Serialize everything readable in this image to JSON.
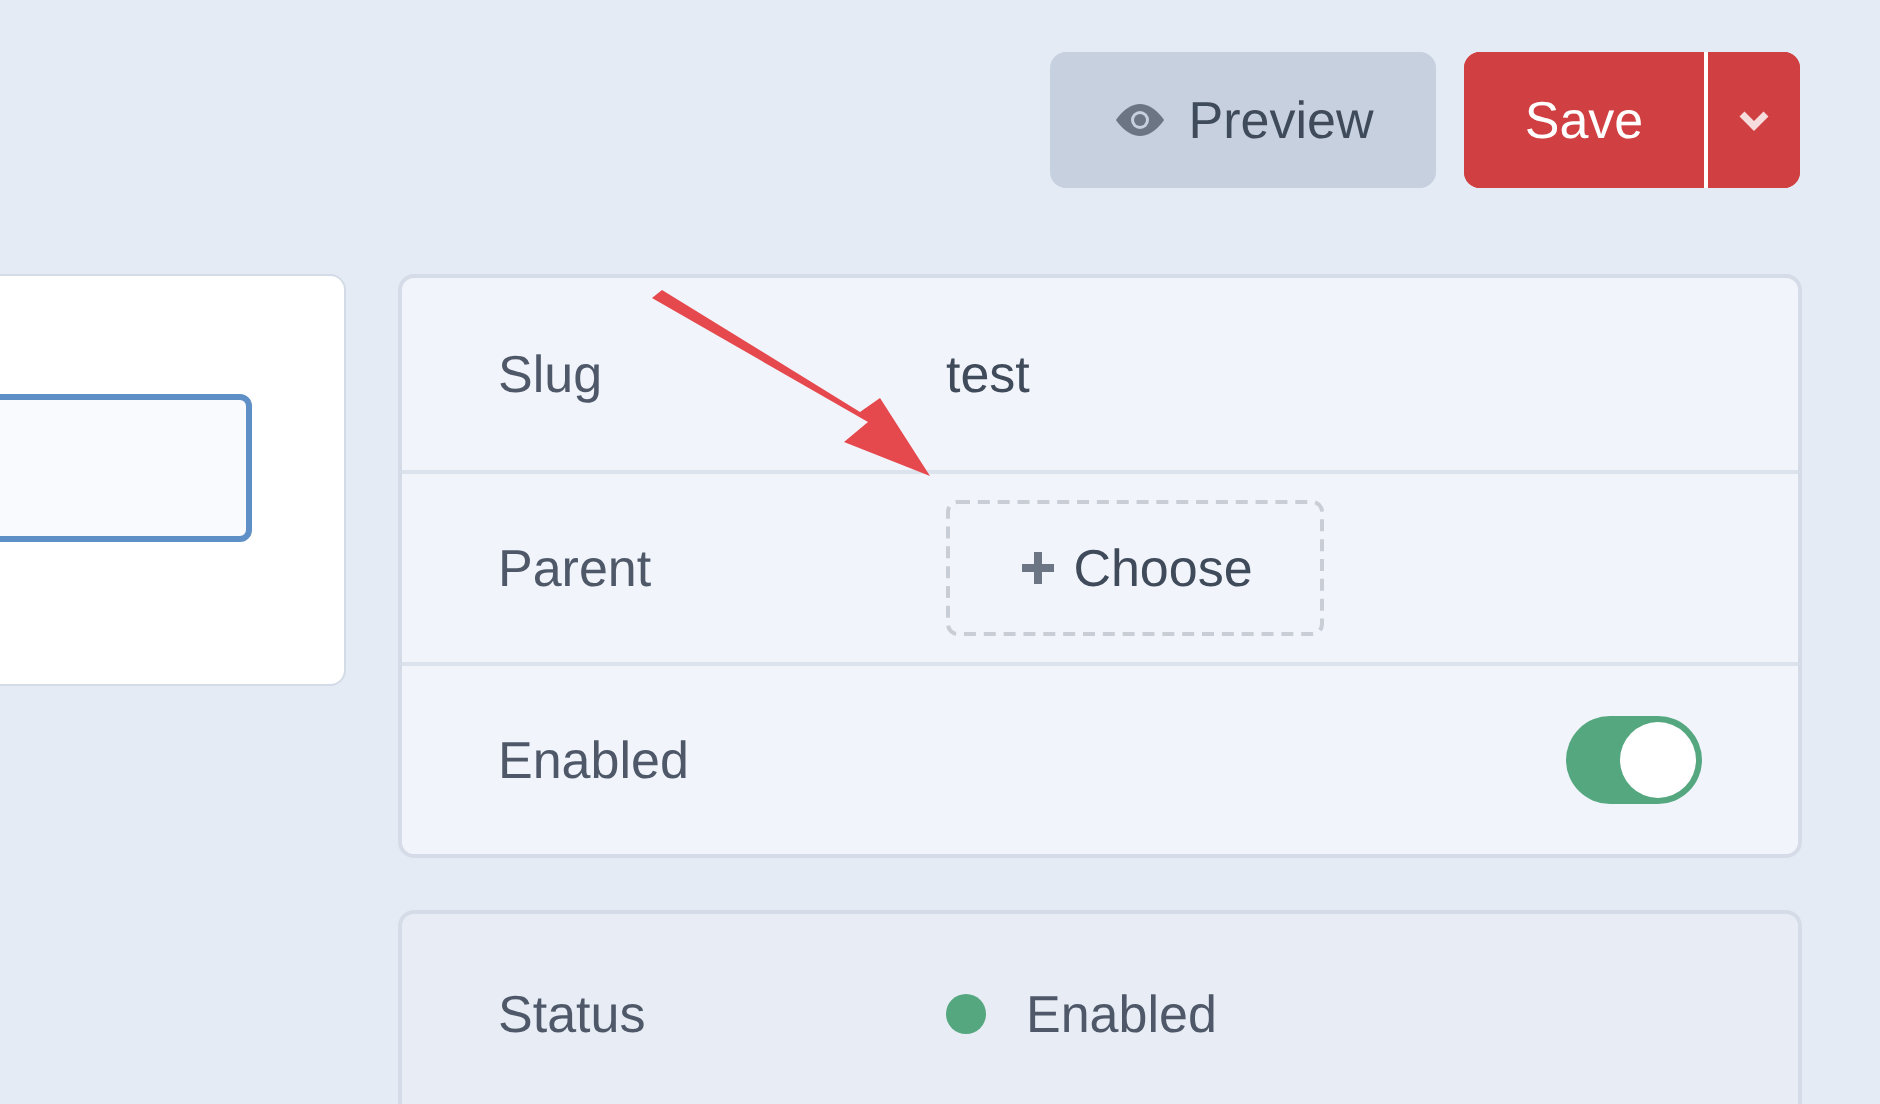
{
  "toolbar": {
    "preview_button": "Preview",
    "save_button": "Save"
  },
  "settings": {
    "rows": [
      {
        "kind": "text",
        "label": "Slug",
        "value": "test"
      },
      {
        "kind": "choose",
        "label": "Parent",
        "button": "Choose"
      },
      {
        "kind": "toggle",
        "label": "Enabled",
        "on": true
      }
    ]
  },
  "status": {
    "label": "Status",
    "value": "Enabled",
    "color": "#55a77f"
  }
}
